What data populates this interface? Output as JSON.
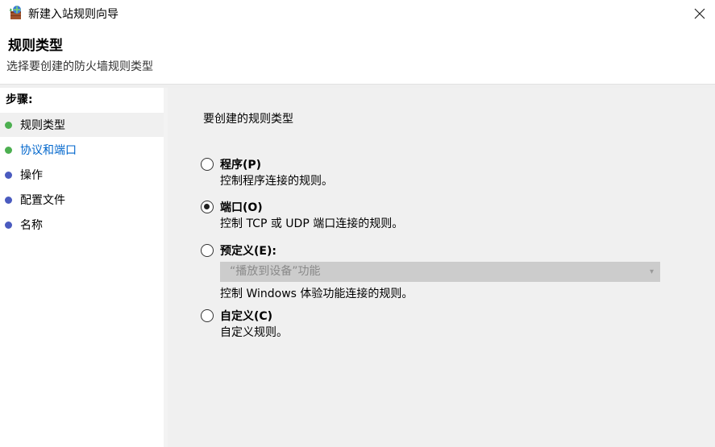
{
  "window": {
    "title": "新建入站规则向导",
    "icon": "firewall-wizard-icon",
    "close_icon": "close-icon"
  },
  "header": {
    "title": "规则类型",
    "subtitle": "选择要创建的防火墙规则类型"
  },
  "sidebar": {
    "heading": "步骤:",
    "items": [
      {
        "label": "规则类型",
        "dot_color": "#4caf50",
        "state": "current"
      },
      {
        "label": "协议和端口",
        "dot_color": "#4caf50",
        "state": "link"
      },
      {
        "label": "操作",
        "dot_color": "#4a5bbf",
        "state": "pending"
      },
      {
        "label": "配置文件",
        "dot_color": "#4a5bbf",
        "state": "pending"
      },
      {
        "label": "名称",
        "dot_color": "#4a5bbf",
        "state": "pending"
      }
    ]
  },
  "main": {
    "question": "要创建的规则类型",
    "options": [
      {
        "label": "程序(P)",
        "description": "控制程序连接的规则。",
        "checked": false
      },
      {
        "label": "端口(O)",
        "description": "控制 TCP 或 UDP 端口连接的规则。",
        "checked": true
      },
      {
        "label": "预定义(E):",
        "select_value": "“播放到设备”功能",
        "description": "控制 Windows 体验功能连接的规则。",
        "checked": false
      },
      {
        "label": "自定义(C)",
        "description": "自定义规则。",
        "checked": false
      }
    ]
  },
  "colors": {
    "content_bg": "#f0f0f0",
    "link": "#0066cc",
    "select_bg": "#cccccc"
  }
}
